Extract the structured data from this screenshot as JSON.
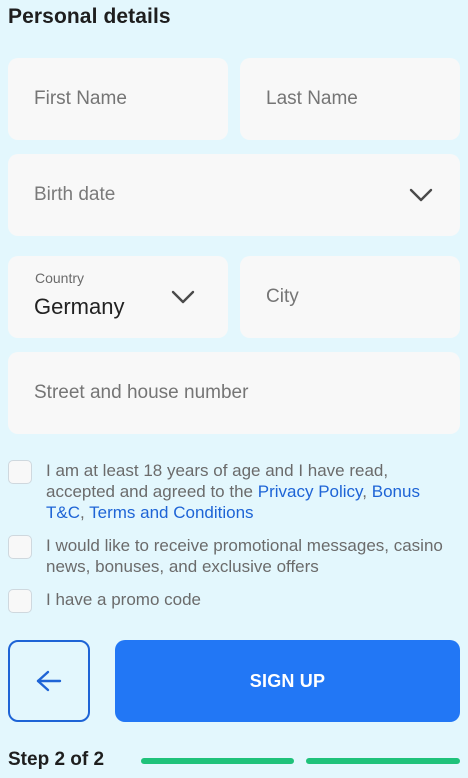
{
  "section_title": "Personal details",
  "fields": {
    "first_name": {
      "placeholder": "First Name",
      "value": ""
    },
    "last_name": {
      "placeholder": "Last Name",
      "value": ""
    },
    "birth_date": {
      "placeholder": "Birth date"
    },
    "country": {
      "label": "Country",
      "value": "Germany"
    },
    "city": {
      "placeholder": "City",
      "value": ""
    },
    "street": {
      "placeholder": "Street and house number",
      "value": ""
    }
  },
  "consents": {
    "age": {
      "text_before": "I am at least 18 years of age and I have read, accepted and agreed to the ",
      "privacy_link": "Privacy Policy",
      "comma1": ",",
      "bonus_link": "Bonus T&C",
      "comma2": ", ",
      "terms_link": "Terms and Conditions",
      "checked": false
    },
    "promo_messages": {
      "text": "I would like to receive promotional messages, casino news, bonuses, and exclusive offers",
      "checked": false
    },
    "promo_code": {
      "text": "I have a promo code",
      "checked": false
    }
  },
  "buttons": {
    "back_icon": "arrow-left-icon",
    "signup_label": "SIGN UP"
  },
  "progress": {
    "step_label": "Step 2 of 2",
    "current": 2,
    "total": 2
  },
  "colors": {
    "background": "#e3f7fd",
    "field_bg": "#f8f8f8",
    "primary": "#2277f5",
    "link": "#1e64d6",
    "progress": "#1fc27a"
  }
}
